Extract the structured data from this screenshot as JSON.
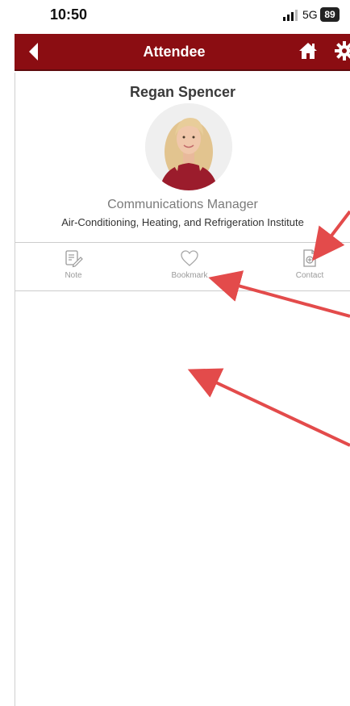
{
  "status_bar": {
    "time": "10:50",
    "network": "5G",
    "battery": "89"
  },
  "navbar": {
    "title": "Attendee",
    "color": "#8b0d12",
    "back_icon": "chevron-left-icon",
    "home_icon": "home-icon",
    "settings_icon": "gear-icon"
  },
  "attendee": {
    "name": "Regan Spencer",
    "role": "Communications Manager",
    "organization": "Air-Conditioning, Heating, and Refrigeration Institute"
  },
  "actions": [
    {
      "label": "Note",
      "icon": "note-edit-icon"
    },
    {
      "label": "Bookmark",
      "icon": "heart-icon"
    },
    {
      "label": "Contact",
      "icon": "add-contact-icon"
    }
  ],
  "annotation_color": "#e34b4b"
}
